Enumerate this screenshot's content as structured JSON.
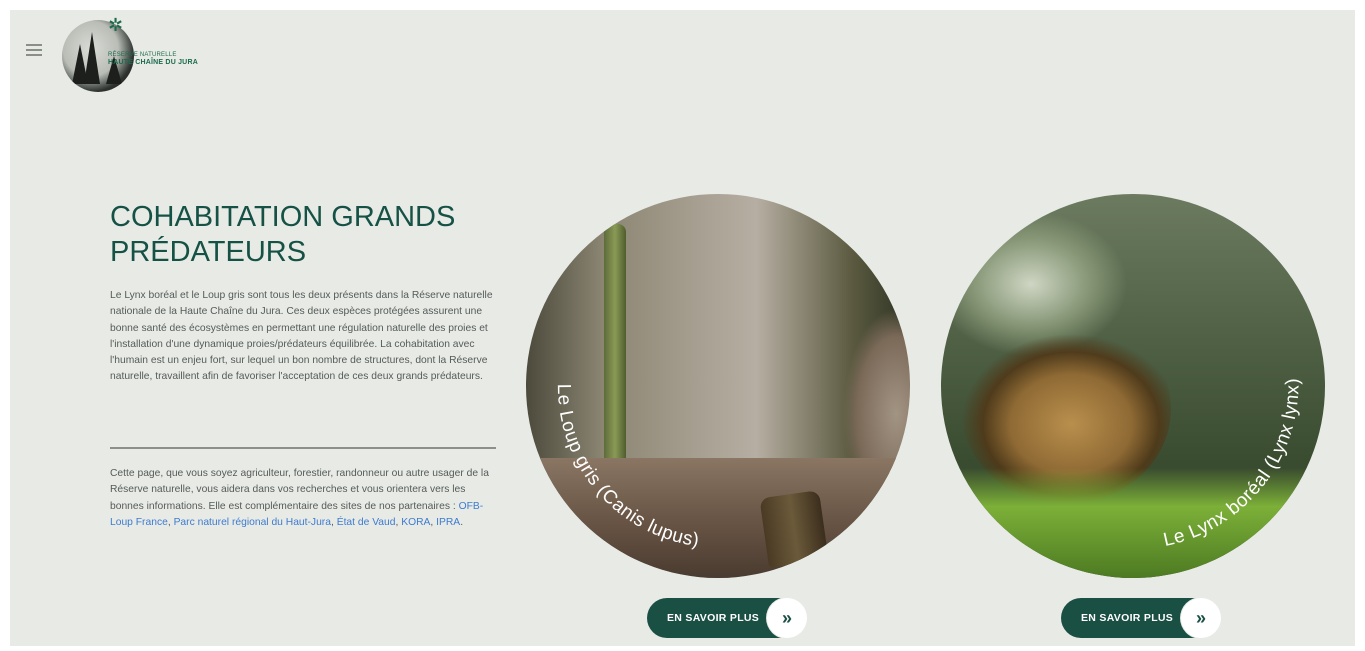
{
  "header": {
    "menu_icon": "hamburger-menu-icon",
    "logo": {
      "small_text": "RÉSERVE NATURELLE",
      "name": "HAUTE CHAÎNE DU JURA"
    }
  },
  "section": {
    "title": "COHABITATION GRANDS PRÉDATEURS",
    "intro": "Le Lynx boréal et le Loup gris sont tous les deux présents dans la Réserve naturelle nationale de la Haute Chaîne du Jura. Ces deux espèces protégées assurent une bonne santé des écosystèmes en permettant une régulation naturelle des proies et l'installation d'une dynamique proies/prédateurs équilibrée. La cohabitation avec l'humain est un enjeu fort, sur lequel un bon nombre de structures, dont la Réserve naturelle, travaillent afin de favoriser l'acceptation de ces deux grands prédateurs.",
    "second_text": "Cette page, que vous soyez agriculteur, forestier, randonneur ou autre usager de la Réserve naturelle, vous aidera dans vos recherches et vous orientera vers les bonnes informations. Elle est complémentaire des sites de nos partenaires : ",
    "links": [
      {
        "label": "OFB-Loup France",
        "sep": ", "
      },
      {
        "label": "Parc naturel régional du Haut-Jura",
        "sep": ", "
      },
      {
        "label": "État de Vaud",
        "sep": ", "
      },
      {
        "label": "KORA",
        "sep": ", "
      },
      {
        "label": "IPRA",
        "sep": "."
      }
    ]
  },
  "cards": [
    {
      "label": "Le Loup gris (Canis lupus)",
      "button": "EN SAVOIR PLUS",
      "icon": "double-chevron-right-icon"
    },
    {
      "label": "Le Lynx boréal (Lynx lynx)",
      "button": "EN SAVOIR PLUS",
      "icon": "double-chevron-right-icon"
    }
  ]
}
